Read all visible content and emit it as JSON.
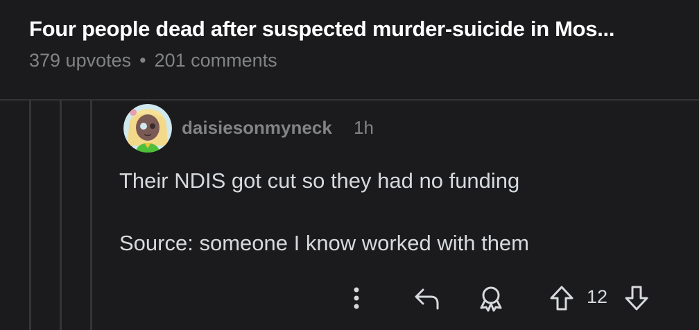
{
  "post": {
    "title": "Four people dead after suspected murder-suicide in Mos...",
    "upvotes": "379 upvotes",
    "separator": "•",
    "comments": "201 comments"
  },
  "comment": {
    "author": "daisiesonmyneck",
    "time": "1h",
    "lines": [
      "Their NDIS got cut so they had no funding",
      "Source: someone I know worked with them"
    ],
    "score": "12"
  },
  "icons": {
    "more": "more-vertical-icon",
    "reply": "reply-icon",
    "award": "award-icon",
    "upvote": "upvote-icon",
    "downvote": "downvote-icon"
  },
  "colors": {
    "background": "#1b1b1d",
    "title": "#ffffff",
    "meta": "#818384",
    "body_text": "#d7dadc",
    "thread_line": "#343536"
  }
}
